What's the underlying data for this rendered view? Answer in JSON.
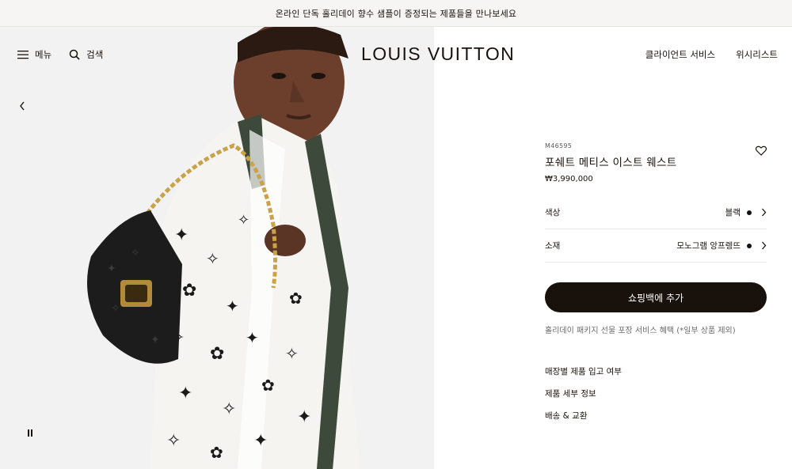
{
  "promo": {
    "text": "온라인 단독 홀리데이 향수 샘플이 증정되는 제품들을 만나보세요"
  },
  "header": {
    "menu_label": "메뉴",
    "search_label": "검색",
    "logo": "LOUIS VUITTON",
    "client_service": "클라이언트 서비스",
    "wishlist": "위시리스트"
  },
  "product": {
    "sku": "M46595",
    "name": "포쉐트 메티스 이스트 웨스트",
    "price": "₩3,990,000",
    "color_label": "색상",
    "color_value": "블랙",
    "material_label": "소재",
    "material_value": "모노그램 앙프렝뜨",
    "add_to_bag": "쇼핑백에 추가",
    "gift_note": "홀리데이 패키지 선물 포장 서비스 혜택 (*일부 상품 제외)",
    "links": [
      "매장별 제품 입고 여부",
      "제품 세부 정보",
      "배송 & 교환"
    ]
  },
  "colors": {
    "brand_dark": "#19110b",
    "promo_bg": "#f6f5f3"
  }
}
